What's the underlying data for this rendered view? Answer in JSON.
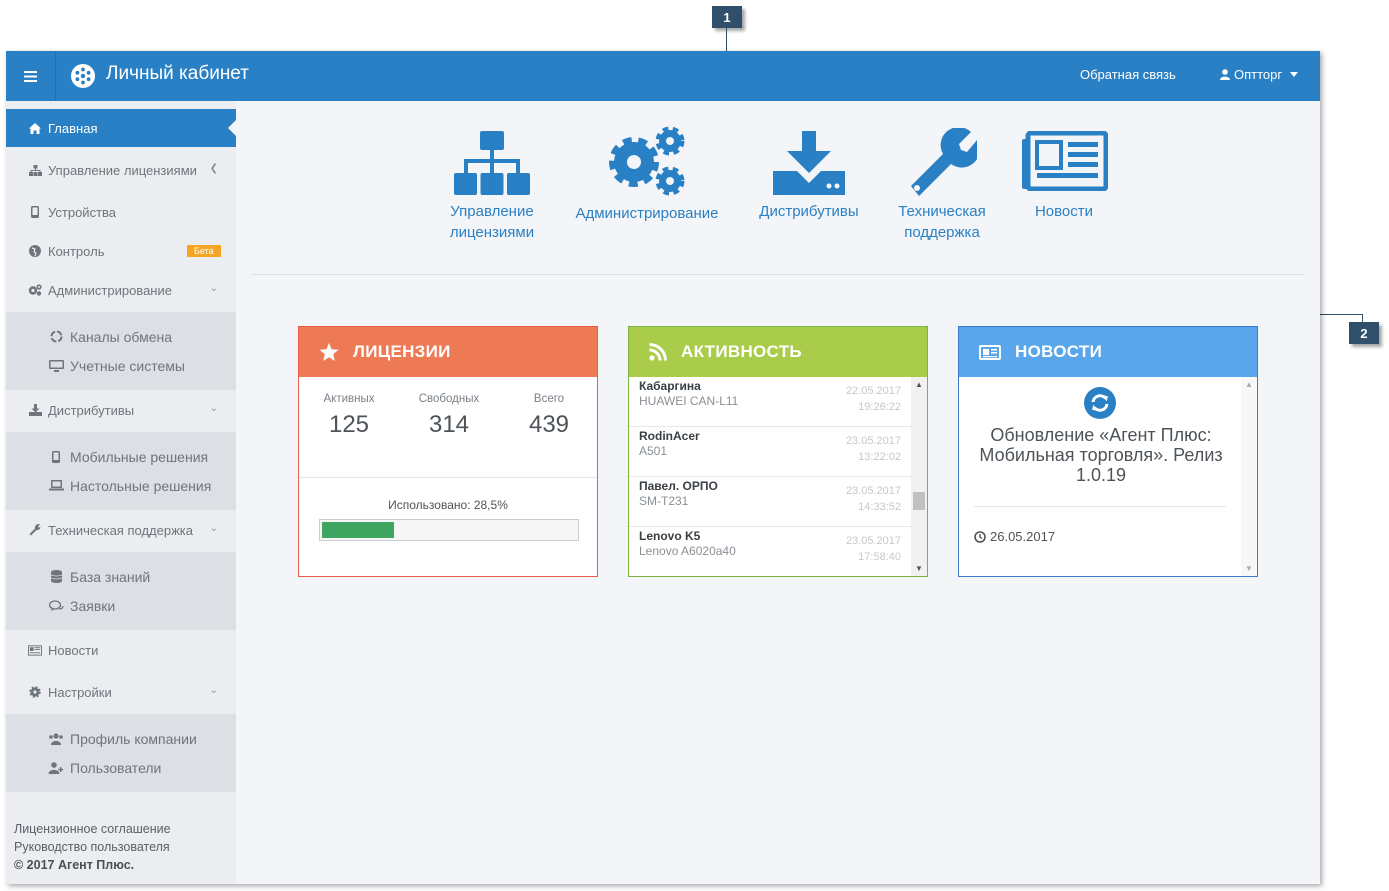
{
  "callouts": {
    "one": "1",
    "two": "2"
  },
  "header": {
    "title": "Личный кабинет",
    "feedback": "Обратная связь",
    "user": "Оптторг"
  },
  "sidebar": {
    "items": [
      {
        "label": "Главная"
      },
      {
        "label": "Управление лицензиями"
      },
      {
        "label": "Устройства"
      },
      {
        "label": "Контроль",
        "badge": "Бета"
      },
      {
        "label": "Администрирование"
      },
      {
        "label": "Дистрибутивы"
      },
      {
        "label": "Техническая поддержка"
      },
      {
        "label": "Новости"
      },
      {
        "label": "Настройки"
      }
    ],
    "admin_sub": [
      "Каналы обмена",
      "Учетные системы"
    ],
    "dist_sub": [
      "Мобильные решения",
      "Настольные решения"
    ],
    "support_sub": [
      "База знаний",
      "Заявки"
    ],
    "settings_sub": [
      "Профиль компании",
      "Пользователи"
    ],
    "footer": {
      "license": "Лицензионное соглашение",
      "guide": "Руководство пользователя",
      "copyright": "© 2017 Агент Плюс."
    }
  },
  "tiles": [
    {
      "line1": "Управление",
      "line2": "лицензиями",
      "icon": "sitemap-icon"
    },
    {
      "line1": "Администрирование",
      "line2": "",
      "icon": "gears-icon"
    },
    {
      "line1": "Дистрибутивы",
      "line2": "",
      "icon": "download-icon"
    },
    {
      "line1": "Техническая",
      "line2": "поддержка",
      "icon": "wrench-icon"
    },
    {
      "line1": "Новости",
      "line2": "",
      "icon": "newspaper-icon"
    }
  ],
  "licenses": {
    "title": "ЛИЦЕНЗИИ",
    "active_label": "Активных",
    "active": "125",
    "free_label": "Свободных",
    "free": "314",
    "total_label": "Всего",
    "total": "439",
    "used_text": "Использовано: 28,5%",
    "used_fraction": 0.285
  },
  "activity": {
    "title": "АКТИВНОСТЬ",
    "rows": [
      {
        "name": "Кабаргина",
        "device": "HUAWEI CAN-L11",
        "date": "22.05.2017",
        "time": "19:26:22"
      },
      {
        "name": "RodinAcer",
        "device": "A501",
        "date": "23.05.2017",
        "time": "13:22:02"
      },
      {
        "name": "Павел. ОРПО",
        "device": "SM-T231",
        "date": "23.05.2017",
        "time": "14:33:52"
      },
      {
        "name": "Lenovo K5",
        "device": "Lenovo A6020a40",
        "date": "23.05.2017",
        "time": "17:58:40"
      }
    ]
  },
  "news": {
    "title": "НОВОСТИ",
    "headline": "Обновление «Агент Плюс: Мобильная торговля». Релиз 1.0.19",
    "date": "26.05.2017"
  },
  "colors": {
    "primary": "#2a80c4",
    "licenses": "#ee7a55",
    "activity": "#a9cc4a",
    "news": "#5aa6ea",
    "progress": "#3ea660",
    "beta": "#f5a623"
  }
}
